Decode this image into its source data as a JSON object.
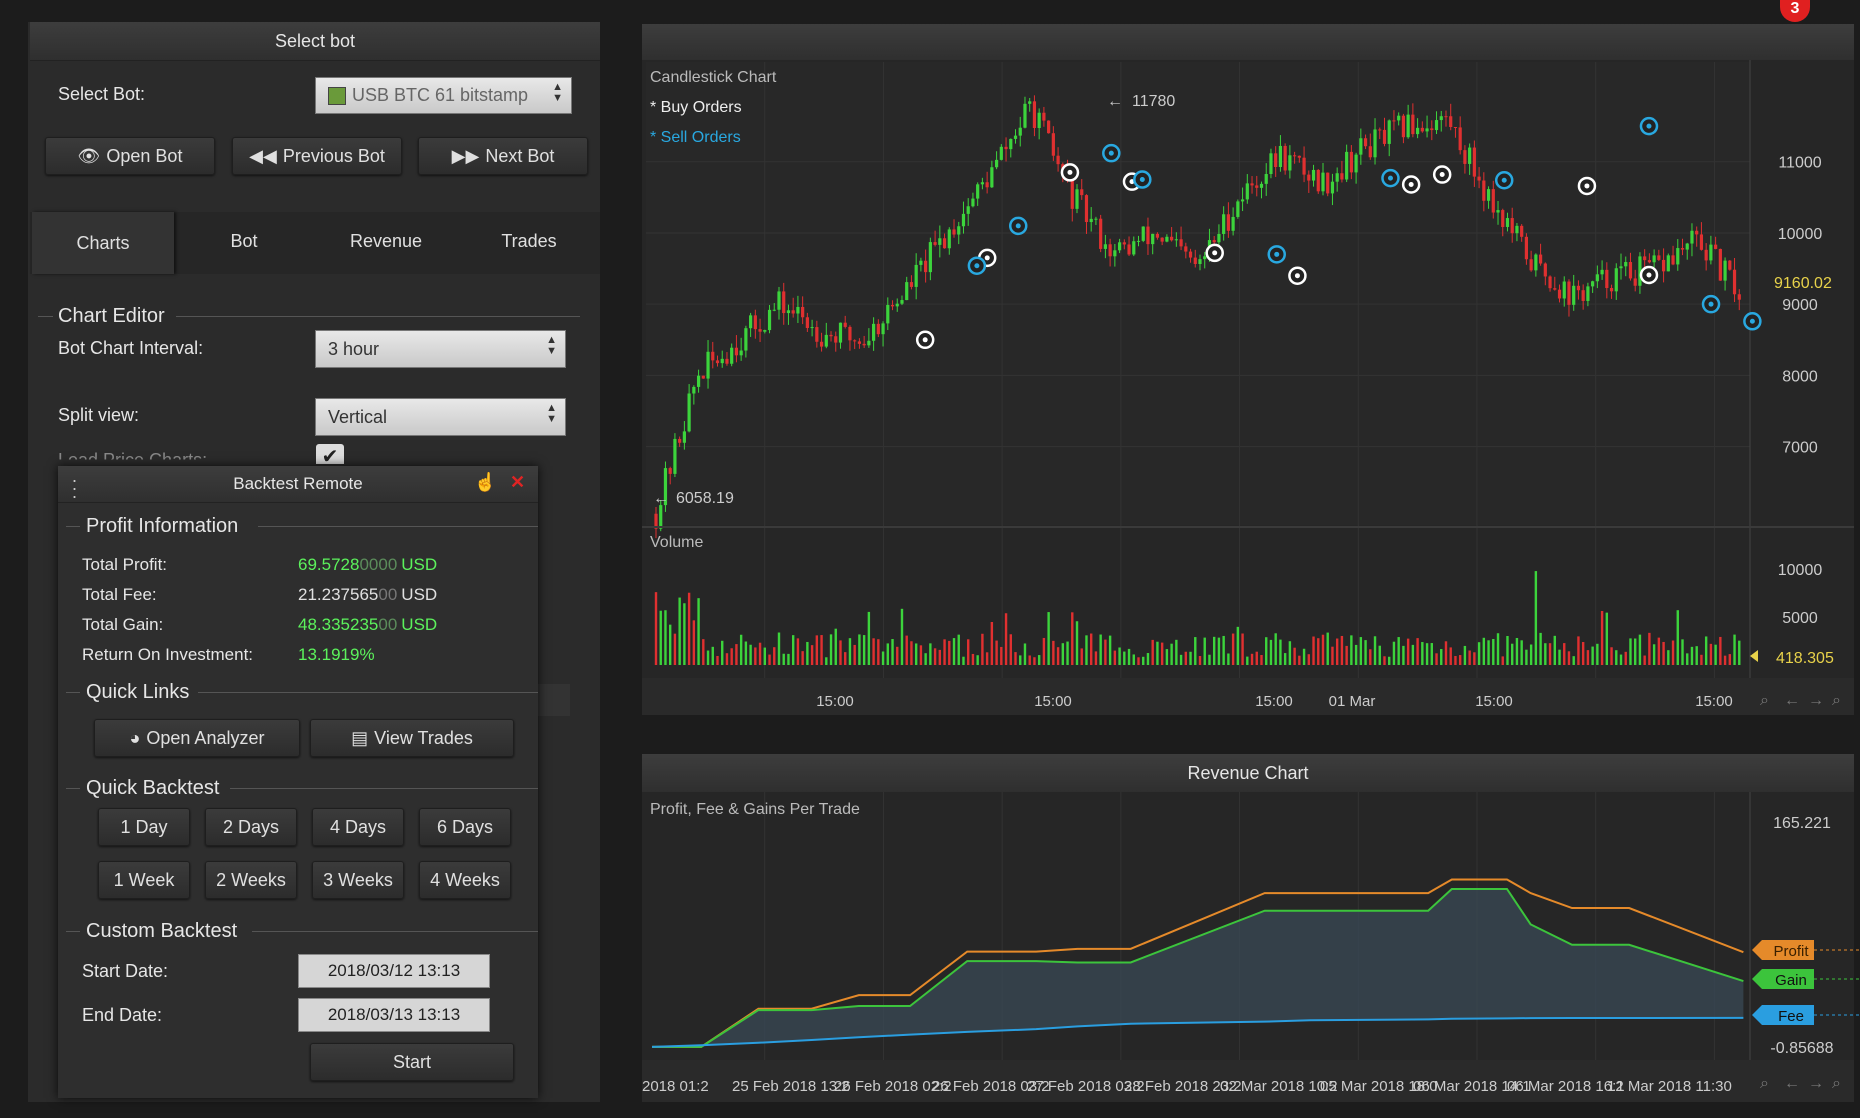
{
  "top_badge": "3",
  "select_bot_panel": {
    "title": "Select bot",
    "select_label": "Select Bot:",
    "bot_value": "USB BTC 61 bitstamp",
    "open_btn": "Open Bot",
    "prev_btn": "Previous Bot",
    "next_btn": "Next Bot",
    "tabs": [
      "Charts",
      "Bot",
      "Revenue",
      "Trades"
    ],
    "chart_editor": "Chart Editor",
    "interval_label": "Bot Chart Interval:",
    "interval_value": "3 hour",
    "split_label": "Split view:",
    "split_value": "Vertical",
    "load_label": "Load Price Charts:"
  },
  "backtest": {
    "title": "Backtest Remote",
    "profit_info": "Profit Information",
    "rows": [
      {
        "label": "Total Profit:",
        "main": "69.5728",
        "faded": "0000",
        "unit": "USD",
        "color": "#5cf25c"
      },
      {
        "label": "Total Fee:",
        "main": "21.237565",
        "faded": "00",
        "unit": "USD",
        "color": "#e0e0e0"
      },
      {
        "label": "Total Gain:",
        "main": "48.335235",
        "faded": "00",
        "unit": "USD",
        "color": "#5cf25c"
      },
      {
        "label": "Return On Investment:",
        "main": "13.1919%",
        "faded": "",
        "unit": "",
        "color": "#5cf25c"
      }
    ],
    "quick_links": "Quick Links",
    "analyzer_btn": "Open Analyzer",
    "trades_btn": "View Trades",
    "quick_backtest": "Quick Backtest",
    "quick_buttons": [
      "1 Day",
      "2 Days",
      "4 Days",
      "6 Days",
      "1 Week",
      "2 Weeks",
      "3 Weeks",
      "4 Weeks"
    ],
    "custom_backtest": "Custom Backtest",
    "start_label": "Start Date:",
    "start_value": "2018/03/12 13:13",
    "end_label": "End Date:",
    "end_value": "2018/03/13 13:13",
    "start_btn": "Start"
  },
  "candle_chart": {
    "title": "Candlestick Chart",
    "legend_buy": "* Buy Orders",
    "legend_sell": "* Sell Orders",
    "high_label": "11780",
    "low_label": "6058.19",
    "current_price": "9160.02",
    "volume_title": "Volume",
    "current_volume": "418.305",
    "time_labels": [
      "15:00",
      "15:00",
      "15:00",
      "01 Mar",
      "15:00",
      "15:00"
    ]
  },
  "revenue_chart": {
    "title": "Revenue Chart",
    "subtitle": "Profit, Fee & Gains Per Trade",
    "tags": [
      "Profit",
      "Gain",
      "Fee"
    ],
    "x_labels": [
      "2018 01:2",
      "25 Feb 2018 13:2",
      "26 Feb 2018 02:2",
      "26 Feb 2018 03:2",
      "27 Feb 2018 03:2",
      "28 Feb 2018 23:2",
      "02 Mar 2018 10:2",
      "05 Mar 2018 18:0",
      "06 Mar 2018 14:1",
      "06 Mar 2018 16:1",
      "12 Mar 2018 11:30"
    ]
  },
  "chart_data": [
    {
      "type": "candlestick",
      "title": "Candlestick Chart",
      "y_ticks": [
        7000,
        8000,
        9000,
        10000,
        11000
      ],
      "ylim": [
        5900,
        12400
      ],
      "x_ticks": [
        "15:00",
        "15:00",
        "15:00",
        "01 Mar",
        "15:00",
        "15:00"
      ],
      "close_trend": [
        6058.19,
        8000,
        8500,
        9000,
        8600,
        8500,
        9200,
        10000,
        10800,
        11780,
        10500,
        9700,
        10000,
        9500,
        10500,
        11100,
        10700,
        11200,
        11500,
        11600,
        10500,
        9600,
        9100,
        9400,
        9500,
        9900,
        9160.02
      ],
      "annotations": {
        "high": 11780,
        "low": 6058.19,
        "last": 9160.02
      },
      "series": [
        {
          "name": "Buy Orders"
        },
        {
          "name": "Sell Orders"
        }
      ],
      "buy_orders": [
        [
          0.27,
          8500
        ],
        [
          0.33,
          9650
        ],
        [
          0.41,
          10850
        ],
        [
          0.47,
          10720
        ],
        [
          0.55,
          9720
        ],
        [
          0.63,
          9400
        ],
        [
          0.74,
          10680
        ],
        [
          0.77,
          10820
        ],
        [
          0.91,
          10660
        ],
        [
          0.97,
          9410
        ]
      ],
      "sell_orders": [
        [
          0.32,
          9540
        ],
        [
          0.36,
          10100
        ],
        [
          0.45,
          11120
        ],
        [
          0.48,
          10750
        ],
        [
          0.61,
          9700
        ],
        [
          0.72,
          10770
        ],
        [
          0.83,
          10740
        ],
        [
          0.97,
          11500
        ],
        [
          1.03,
          9000
        ],
        [
          1.07,
          8760
        ]
      ]
    },
    {
      "type": "bar",
      "title": "Volume",
      "y_ticks": [
        5000,
        10000
      ],
      "ylim": [
        0,
        12000
      ],
      "annotations": {
        "last": 418.305
      }
    },
    {
      "type": "area",
      "title": "Revenue Chart",
      "y_annotations": {
        "max": 165.221,
        "min": -0.85688
      },
      "x": [
        "2018 01:2",
        "25 Feb 2018 13:2",
        "26 Feb 2018 02:2",
        "26 Feb 2018 03:2",
        "27 Feb 2018 03:2",
        "28 Feb 2018 23:2",
        "02 Mar 2018 10:2",
        "05 Mar 2018 18:0",
        "06 Mar 2018 14:1",
        "06 Mar 2018 16:1",
        "12 Mar 2018 11:30"
      ],
      "series": [
        {
          "name": "Profit",
          "color": "#e58a2a",
          "values": [
            0,
            0,
            28,
            28,
            38,
            38,
            70,
            70,
            72,
            72,
            113,
            113,
            113,
            123,
            123,
            113,
            102,
            102,
            69.57
          ]
        },
        {
          "name": "Gain",
          "color": "#3cc43c",
          "values": [
            0,
            0,
            27,
            27,
            30,
            30,
            63,
            63,
            62,
            62,
            100,
            100,
            100,
            116,
            116,
            90,
            75,
            75,
            48.34
          ]
        },
        {
          "name": "Fee",
          "color": "#2a9ee0",
          "values": [
            0,
            1.2,
            3,
            5,
            7,
            9,
            11,
            13,
            15,
            17,
            18.5,
            19.5,
            20.2,
            20.6,
            20.9,
            21.1,
            21.2,
            21.22,
            21.24
          ]
        }
      ]
    }
  ]
}
